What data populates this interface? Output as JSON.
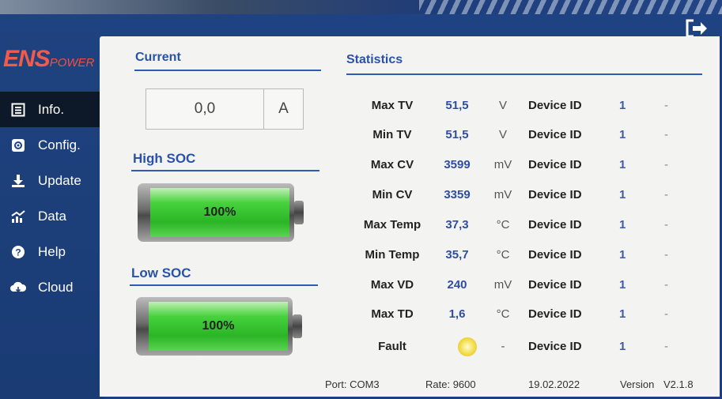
{
  "brand": {
    "logo_main": "ENS",
    "logo_sub": "POWER"
  },
  "sidebar": {
    "items": [
      {
        "label": "Info.",
        "icon": "list-icon",
        "active": true
      },
      {
        "label": "Config.",
        "icon": "gear-icon",
        "active": false
      },
      {
        "label": "Update",
        "icon": "download-icon",
        "active": false
      },
      {
        "label": "Data",
        "icon": "chart-icon",
        "active": false
      },
      {
        "label": "Help",
        "icon": "help-icon",
        "active": false
      },
      {
        "label": "Cloud",
        "icon": "cloud-icon",
        "active": false
      }
    ]
  },
  "header": {
    "exit_icon": "logout-icon"
  },
  "current": {
    "title": "Current",
    "value": "0,0",
    "unit": "A"
  },
  "high_soc": {
    "title": "High SOC",
    "percent_label": "100%",
    "level": 100
  },
  "low_soc": {
    "title": "Low SOC",
    "percent_label": "100%",
    "level": 100
  },
  "statistics": {
    "title": "Statistics",
    "rows": [
      {
        "label": "Max TV",
        "value": "51,5",
        "unit": "V",
        "device_label": "Device ID",
        "device_id": "1",
        "dash": "-"
      },
      {
        "label": "Min TV",
        "value": "51,5",
        "unit": "V",
        "device_label": "Device ID",
        "device_id": "1",
        "dash": "-"
      },
      {
        "label": "Max CV",
        "value": "3599",
        "unit": "mV",
        "device_label": "Device ID",
        "device_id": "1",
        "dash": "-"
      },
      {
        "label": "Min CV",
        "value": "3359",
        "unit": "mV",
        "device_label": "Device ID",
        "device_id": "1",
        "dash": "-"
      },
      {
        "label": "Max Temp",
        "value": "37,3",
        "unit": "°C",
        "device_label": "Device ID",
        "device_id": "1",
        "dash": "-"
      },
      {
        "label": "Min Temp",
        "value": "35,7",
        "unit": "°C",
        "device_label": "Device ID",
        "device_id": "1",
        "dash": "-"
      },
      {
        "label": "Max VD",
        "value": "240",
        "unit": "mV",
        "device_label": "Device ID",
        "device_id": "1",
        "dash": "-"
      },
      {
        "label": "Max TD",
        "value": "1,6",
        "unit": "°C",
        "device_label": "Device ID",
        "device_id": "1",
        "dash": "-"
      }
    ],
    "fault": {
      "label": "Fault",
      "unit": "-",
      "device_label": "Device ID",
      "device_id": "1",
      "dash": "-",
      "indicator_color": "#f2dc46"
    }
  },
  "status_bar": {
    "port_label": "Port:",
    "port_value": "COM3",
    "rate_label": "Rate:",
    "rate_value": "9600",
    "date": "19.02.2022",
    "version_label": "Version",
    "version_value": "V2.1.8"
  },
  "colors": {
    "sidebar": "#1a3b74",
    "accent": "#2a52a8",
    "active_nav": "#0d1829",
    "battery_green": "#2bb526"
  }
}
